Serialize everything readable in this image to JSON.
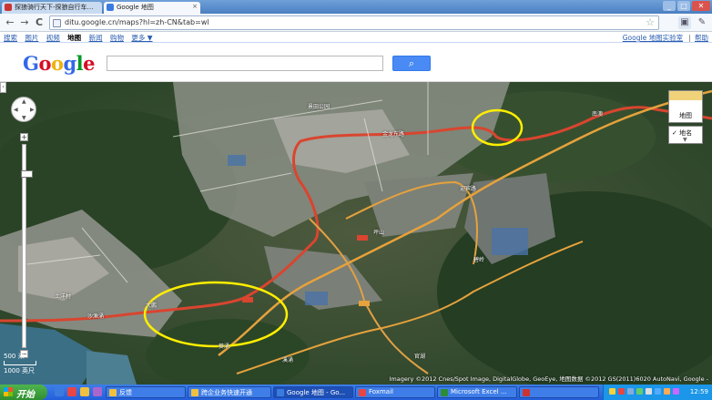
{
  "browser": {
    "tabs": [
      {
        "title": "探狼骑行天下-探狼自行车…",
        "favicon_color": "#cc3333"
      },
      {
        "title": "Google 地图",
        "favicon_color": "#3b7be0"
      }
    ],
    "url": "ditu.google.cn/maps?hl=zh-CN&tab=wl",
    "nav": {
      "back": "←",
      "forward": "→",
      "reload": "C"
    },
    "window_buttons": {
      "minimize": "_",
      "maximize": "□",
      "close": "✕"
    }
  },
  "gbar": {
    "left_links": [
      "搜索",
      "图片",
      "视频",
      "地图",
      "新闻",
      "购物",
      "更多 ▼"
    ],
    "current": "地图",
    "right_links": [
      "Google 地图实验室",
      "帮助"
    ]
  },
  "header": {
    "logo_letters": [
      "G",
      "o",
      "o",
      "g",
      "l",
      "e"
    ],
    "search_value": "",
    "search_button_icon": "search-icon"
  },
  "map": {
    "type_button": "地图",
    "labels_toggle": "✓ 地名",
    "scale_labels": [
      "500 米",
      "1000 英尺"
    ],
    "attribution": "Imagery ©2012 Cnes/Spot Image, DigitalGlobe, GeoEye, 地图数据 ©2012 GS(2011)6020 AutoNavi, Google -",
    "place_labels": [
      "景田公园",
      "金龙东路",
      "迎宾路",
      "坪山",
      "土洋村",
      "大鹏",
      "沙渔涌",
      "葵涌",
      "官湖",
      "碧岭",
      "溪涌",
      "南澳"
    ]
  },
  "taskbar": {
    "start": "开始",
    "tasks": [
      {
        "label": "反馈",
        "color": "#f0c040"
      },
      {
        "label": "跨企业务快速开通",
        "color": "#f0c040"
      },
      {
        "label": "Google 地图 - Go...",
        "color": "#3b7be0"
      },
      {
        "label": "Foxmail",
        "color": "#e84545"
      },
      {
        "label": "Microsoft Excel ...",
        "color": "#2e8b3a"
      },
      {
        "label": "",
        "color": "#cc3333"
      }
    ],
    "active_task": "Google 地图 - Go...",
    "clock": "12:59"
  }
}
